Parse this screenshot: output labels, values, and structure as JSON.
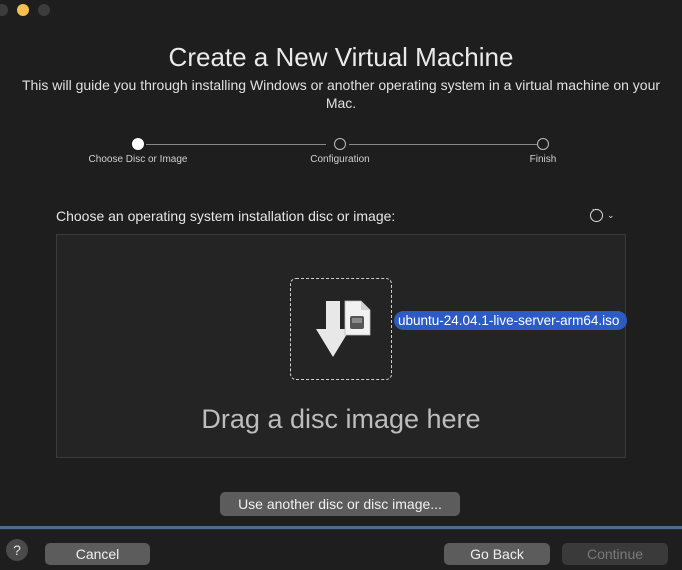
{
  "window": {
    "title": "Create a New Virtual Machine",
    "subtitle": "This will guide you through installing Windows or another operating system in a virtual machine on your Mac."
  },
  "steps": [
    {
      "label": "Choose Disc or Image",
      "active": true
    },
    {
      "label": "Configuration",
      "active": false
    },
    {
      "label": "Finish",
      "active": false
    }
  ],
  "section": {
    "label": "Choose an operating system installation disc or image:",
    "options_icon": "ellipsis-circle-icon"
  },
  "drop_zone": {
    "file_name": "ubuntu-24.04.1-live-server-arm64.iso",
    "hint": "Drag a disc image here",
    "icon": "download-arrow-disc-icon"
  },
  "buttons": {
    "other": "Use another disc or disc image...",
    "help": "?",
    "cancel": "Cancel",
    "back": "Go Back",
    "continue": "Continue"
  },
  "colors": {
    "background": "#1e1e1e",
    "accent": "#2d5bc6",
    "minimize": "#f5bf4f"
  }
}
